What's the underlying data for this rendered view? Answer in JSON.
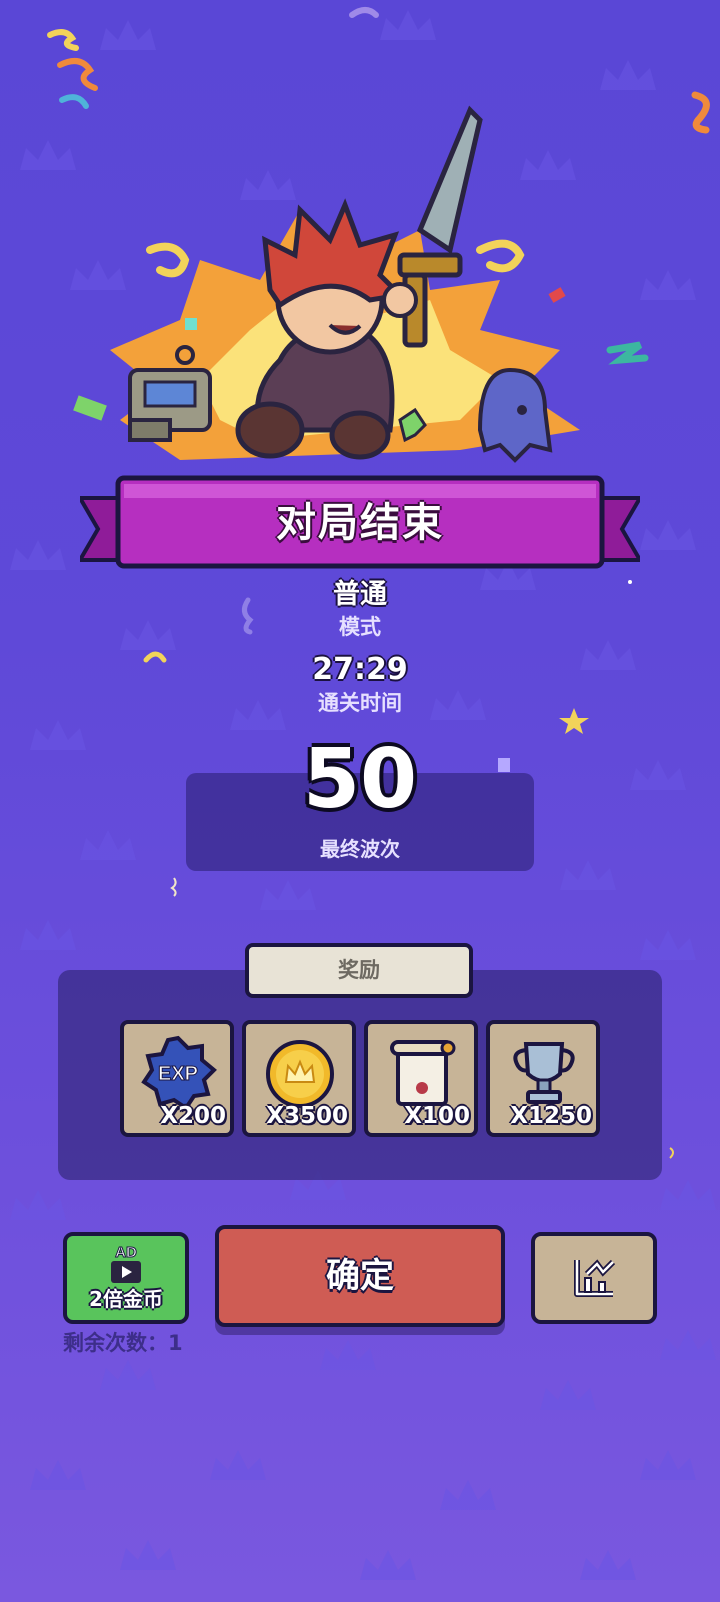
{
  "title": "对局结束",
  "mode": {
    "value": "普通",
    "label": "模式"
  },
  "clear_time": {
    "value": "27:29",
    "label": "通关时间"
  },
  "final_wave": {
    "value": "50",
    "label": "最终波次"
  },
  "rewards": {
    "tab_label": "奖励",
    "items": [
      {
        "icon": "exp-badge-icon",
        "badge_text": "EXP",
        "qty": "X200"
      },
      {
        "icon": "gold-coin-icon",
        "qty": "X3500"
      },
      {
        "icon": "scroll-icon",
        "qty": "X100"
      },
      {
        "icon": "trophy-icon",
        "qty": "X1250"
      }
    ]
  },
  "ad_button": {
    "badge": "AD",
    "label": "2倍金币",
    "remaining": "剩余次数：1"
  },
  "confirm_button": {
    "label": "确定"
  },
  "stats_button": {
    "icon": "stats-chart-icon"
  },
  "colors": {
    "banner": "#b62fc0",
    "confirm": "#cf5c54",
    "ad": "#59c45c",
    "tile": "#c7b497"
  }
}
